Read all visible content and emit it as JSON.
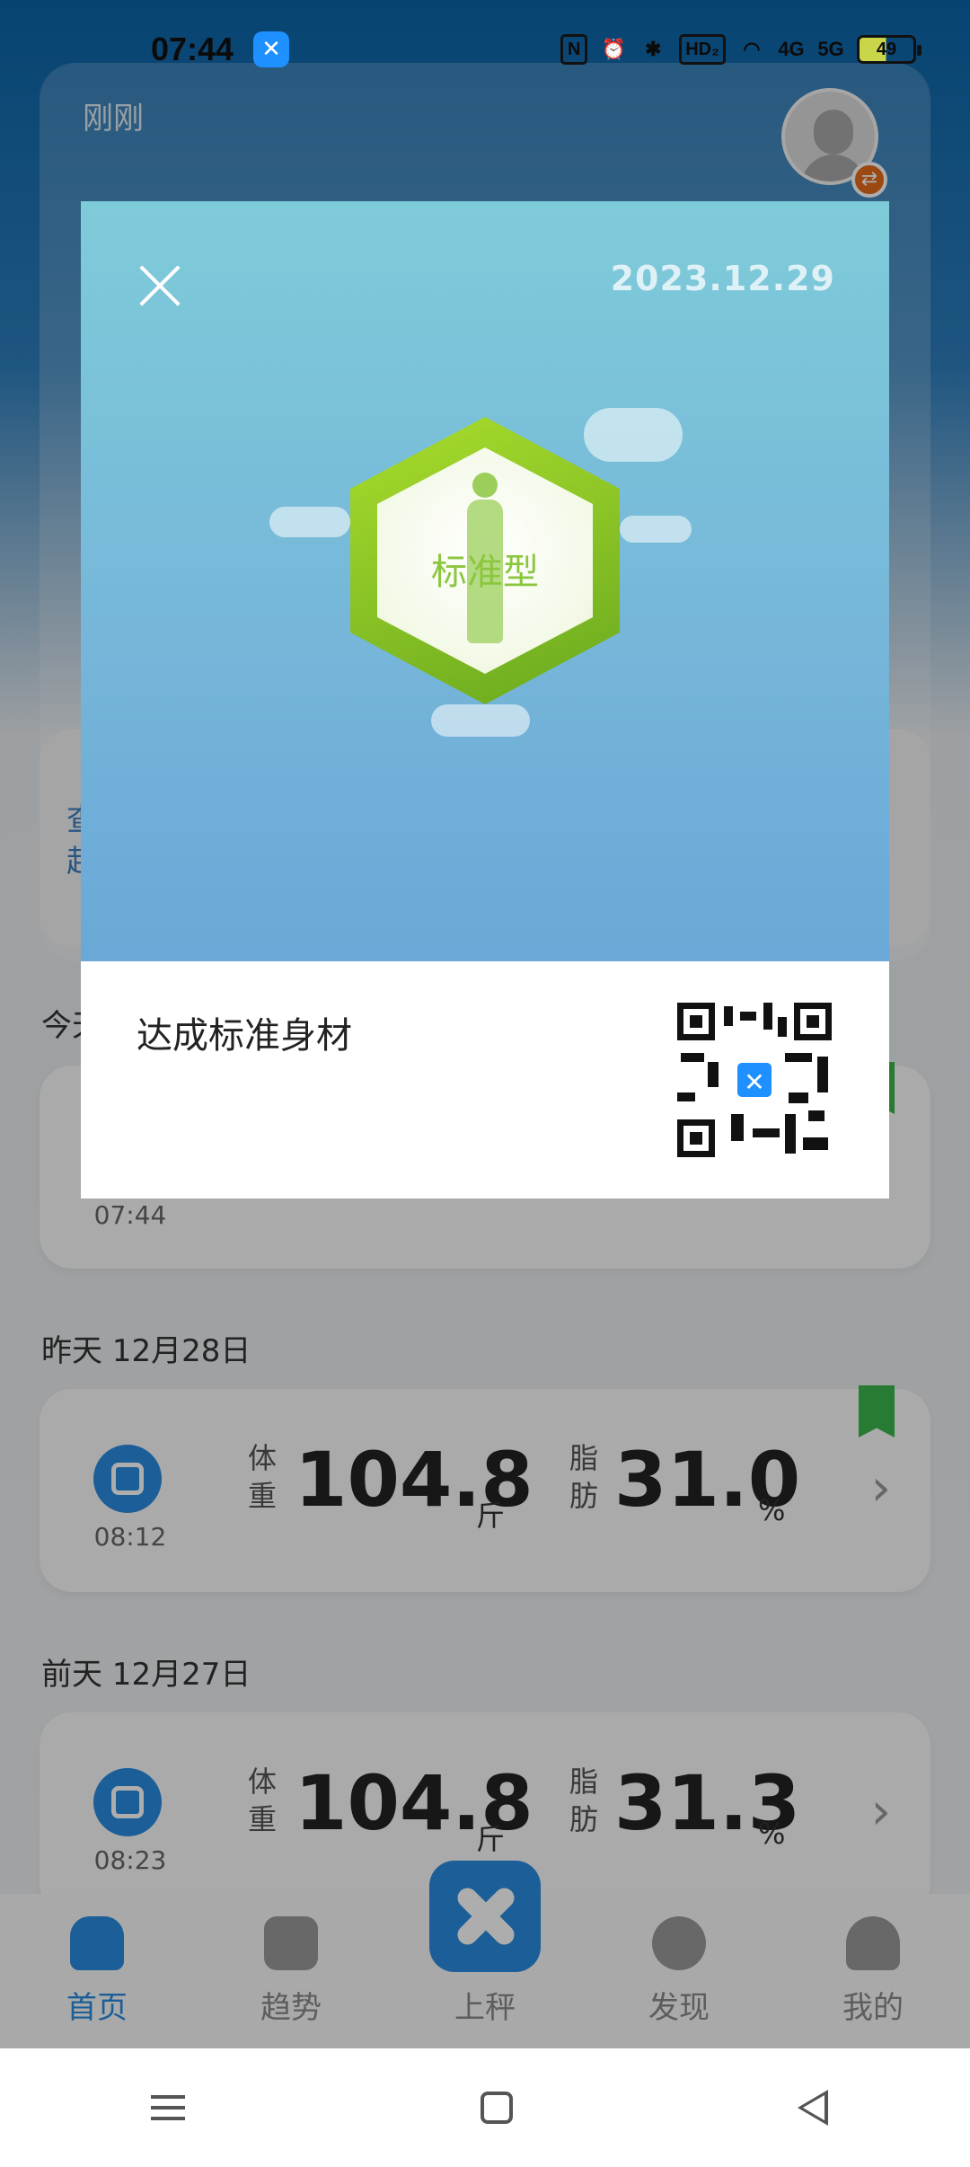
{
  "status_bar": {
    "time": "07:44",
    "app_icon_glyph": "✕",
    "nfc_label": "N",
    "hd_label": "HD₂",
    "net4g_label": "4G",
    "net5g_label": "5G",
    "battery_level": "49"
  },
  "top_card": {
    "just_now": "刚刚"
  },
  "tip_card": {
    "text_line1": "查",
    "text_line2": "起"
  },
  "today": {
    "label": "今天",
    "record_time": "07:44"
  },
  "yesterday": {
    "label": "昨天 12月28日",
    "record": {
      "time": "08:12",
      "weight_label_1": "体",
      "weight_label_2": "重",
      "weight_value": "104.8",
      "weight_unit": "斤",
      "fat_label_1": "脂",
      "fat_label_2": "肪",
      "fat_value": "31.0",
      "fat_unit": "%"
    }
  },
  "day_before": {
    "label": "前天 12月27日",
    "record": {
      "time": "08:23",
      "weight_label_1": "体",
      "weight_label_2": "重",
      "weight_value": "104.8",
      "weight_unit": "斤",
      "fat_label_1": "脂",
      "fat_label_2": "肪",
      "fat_value": "31.3",
      "fat_unit": "%"
    }
  },
  "tabbar": {
    "tabs": [
      {
        "label": "首页",
        "icon": "home-icon"
      },
      {
        "label": "趋势",
        "icon": "trend-icon"
      },
      {
        "label": "上秤",
        "icon": "scale-icon"
      },
      {
        "label": "发现",
        "icon": "planet-icon"
      },
      {
        "label": "我的",
        "icon": "profile-icon"
      }
    ],
    "active_index": 0
  },
  "modal": {
    "date": "2023.12.29",
    "badge_text": "标准型",
    "achievement": "达成标准身材",
    "qr_logo_glyph": "✕",
    "page_count": 5,
    "active_page": 0
  },
  "colors": {
    "accent": "#2a8be0",
    "badge_green": "#8cc63f",
    "modal_top": "#76b7d9"
  }
}
